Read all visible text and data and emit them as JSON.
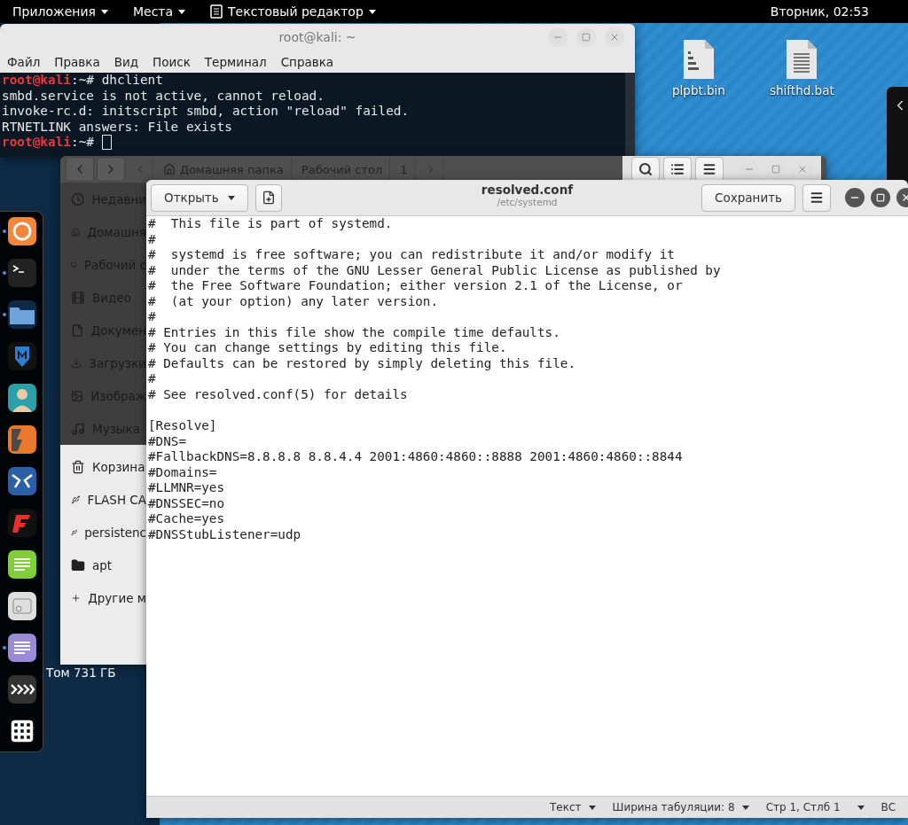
{
  "top_bar": {
    "menus": [
      {
        "label": "Приложения",
        "kind": "plain"
      },
      {
        "label": "Места",
        "kind": "plain"
      },
      {
        "label": "Текстовый редактор",
        "kind": "app"
      }
    ],
    "clock": "Вторник, 02:53"
  },
  "desktop_icons": [
    {
      "label": "plpbt.bin",
      "kind": "binary"
    },
    {
      "label": "shifthd.bat",
      "kind": "text"
    }
  ],
  "desktop_label": "Том 731 ГБ",
  "terminal": {
    "title": "root@kali: ~",
    "menu": [
      "Файл",
      "Правка",
      "Вид",
      "Поиск",
      "Терминал",
      "Справка"
    ],
    "lines": [
      {
        "kind": "prompt",
        "user": "root@kali",
        "text": ":~# dhclient",
        "cursor": false
      },
      {
        "kind": "output",
        "text": "smbd.service is not active, cannot reload."
      },
      {
        "kind": "output",
        "text": "invoke-rc.d: initscript smbd, action \"reload\" failed."
      },
      {
        "kind": "output",
        "text": "RTNETLINK answers: File exists"
      },
      {
        "kind": "prompt",
        "user": "root@kali",
        "text": ":~#",
        "cursor": true
      }
    ]
  },
  "files": {
    "path": [
      {
        "label": "Домашняя папка",
        "kind": "home"
      },
      {
        "label": "Рабочий стол",
        "kind": "plain"
      },
      {
        "label": "1",
        "kind": "plain"
      }
    ],
    "sidebar": [
      {
        "label": "Недавни",
        "kind": "recent",
        "shaded": true
      },
      {
        "label": "Домашня",
        "kind": "home",
        "shaded": true
      },
      {
        "label": "Рабочий с",
        "kind": "desktop",
        "shaded": true
      },
      {
        "label": "Видео",
        "kind": "video",
        "shaded": true
      },
      {
        "label": "Докумен",
        "kind": "documents",
        "shaded": true
      },
      {
        "label": "Загрузки",
        "kind": "downloads",
        "shaded": true
      },
      {
        "label": "Изображ",
        "kind": "pictures",
        "shaded": true
      },
      {
        "label": "Музыка",
        "kind": "music",
        "shaded": true
      },
      {
        "label": "Корзина",
        "kind": "trash",
        "shaded": false
      },
      {
        "label": "FLASH CA",
        "kind": "drive",
        "shaded": false
      },
      {
        "label": "persistenc",
        "kind": "drive",
        "shaded": false
      },
      {
        "label": "apt",
        "kind": "folder",
        "shaded": false
      },
      {
        "label": "Другие м",
        "kind": "other",
        "shaded": false
      }
    ]
  },
  "dock": [
    {
      "kind": "browser",
      "running": true
    },
    {
      "kind": "terminal",
      "running": true
    },
    {
      "kind": "files",
      "running": true
    },
    {
      "kind": "shield",
      "running": false
    },
    {
      "kind": "avatar",
      "running": false
    },
    {
      "kind": "bolt",
      "running": false
    },
    {
      "kind": "mask",
      "running": false
    },
    {
      "kind": "flame",
      "running": false
    },
    {
      "kind": "notes",
      "running": false
    },
    {
      "kind": "radio",
      "running": false
    },
    {
      "kind": "editor",
      "running": true
    },
    {
      "kind": "chevrons",
      "running": false
    },
    {
      "kind": "apps",
      "running": false
    }
  ],
  "editor": {
    "open_button": "Открыть",
    "title": "resolved.conf",
    "subtitle": "/etc/systemd",
    "save_button": "Сохранить",
    "content": "#  This file is part of systemd.\n#\n#  systemd is free software; you can redistribute it and/or modify it\n#  under the terms of the GNU Lesser General Public License as published by\n#  the Free Software Foundation; either version 2.1 of the License, or\n#  (at your option) any later version.\n#\n# Entries in this file show the compile time defaults.\n# You can change settings by editing this file.\n# Defaults can be restored by simply deleting this file.\n#\n# See resolved.conf(5) for details\n\n[Resolve]\n#DNS=\n#FallbackDNS=8.8.8.8 8.8.4.4 2001:4860:4860::8888 2001:4860:4860::8844\n#Domains=\n#LLMNR=yes\n#DNSSEC=no\n#Cache=yes\n#DNSStubListener=udp",
    "status": [
      {
        "label": "Текст",
        "kind": "dropdown"
      },
      {
        "label": "Ширина табуляции: 8",
        "kind": "dropdown"
      },
      {
        "label": "Стр 1, Стлб 1",
        "kind": "plain"
      },
      {
        "kind": "caret"
      },
      {
        "label": "ВС",
        "kind": "plain"
      }
    ]
  }
}
